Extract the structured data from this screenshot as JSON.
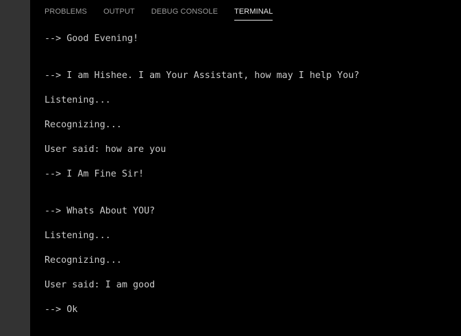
{
  "tabs": [
    {
      "label": "PROBLEMS",
      "active": false
    },
    {
      "label": "OUTPUT",
      "active": false
    },
    {
      "label": "DEBUG CONSOLE",
      "active": false
    },
    {
      "label": "TERMINAL",
      "active": true
    }
  ],
  "terminal": {
    "lines": [
      "--> Good Evening!",
      "--> I am Hishee. I am Your Assistant, how may I help You?",
      "Listening...",
      "Recognizing...",
      "User said: how are you",
      "--> I Am Fine Sir!",
      "--> Whats About YOU?",
      "Listening...",
      "Recognizing...",
      "User said: I am good",
      "--> Ok"
    ]
  },
  "colors": {
    "background": "#000000",
    "activity_strip": "#333333",
    "tab_inactive": "#9d9d9d",
    "tab_active": "#e7e7e7",
    "terminal_text": "#cccccc"
  }
}
